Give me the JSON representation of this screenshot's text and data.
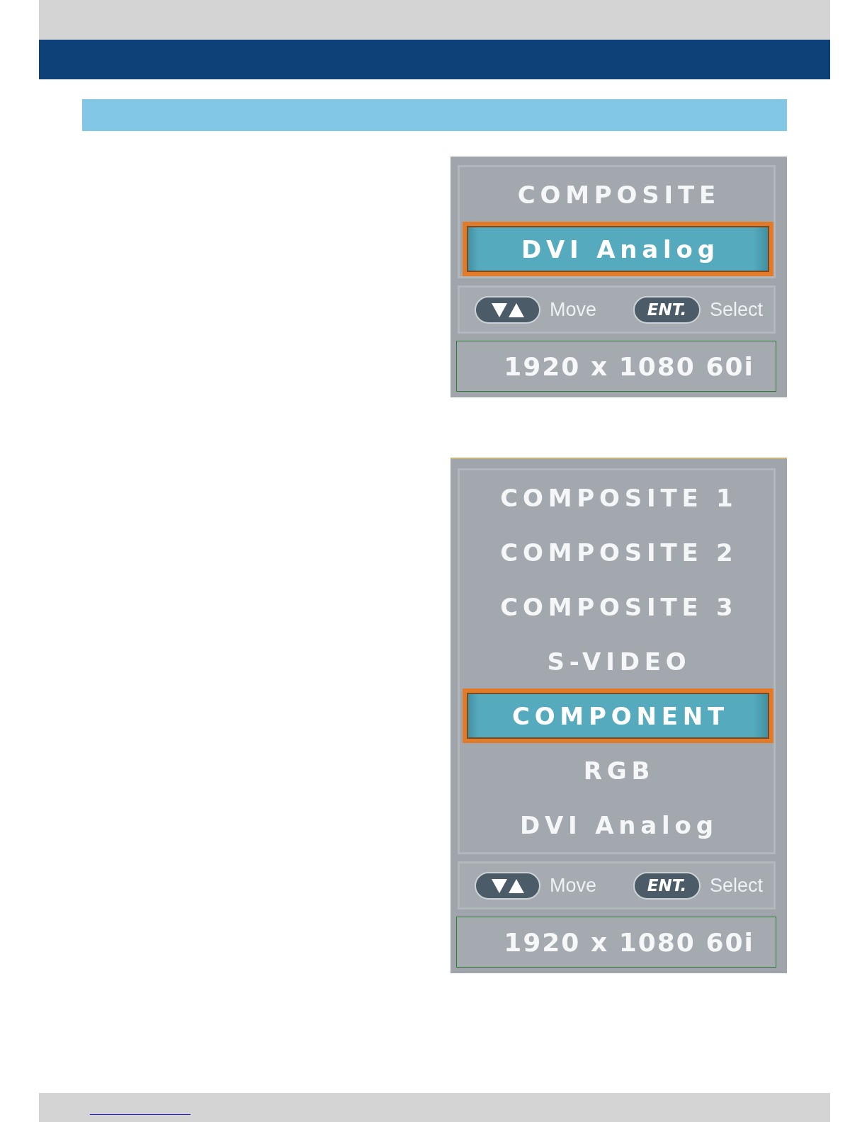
{
  "osd_menus": [
    {
      "items": [
        {
          "label": "COMPOSITE",
          "selected": false
        },
        {
          "label": "DVI Analog",
          "selected": true
        }
      ],
      "help": [
        {
          "kind": "arrows",
          "label": "Move"
        },
        {
          "kind": "enter",
          "key": "ENT.",
          "label": "Select"
        }
      ],
      "resolution": "1920 x 1080 60i"
    },
    {
      "items": [
        {
          "label": "COMPOSITE 1",
          "selected": false
        },
        {
          "label": "COMPOSITE 2",
          "selected": false
        },
        {
          "label": "COMPOSITE 3",
          "selected": false
        },
        {
          "label": "S-VIDEO",
          "selected": false
        },
        {
          "label": "COMPONENT",
          "selected": true
        },
        {
          "label": "RGB",
          "selected": false
        },
        {
          "label": "DVI Analog",
          "selected": false
        }
      ],
      "help": [
        {
          "kind": "arrows",
          "label": "Move"
        },
        {
          "kind": "enter",
          "key": "ENT.",
          "label": "Select"
        }
      ],
      "resolution": "1920 x 1080 60i"
    }
  ]
}
